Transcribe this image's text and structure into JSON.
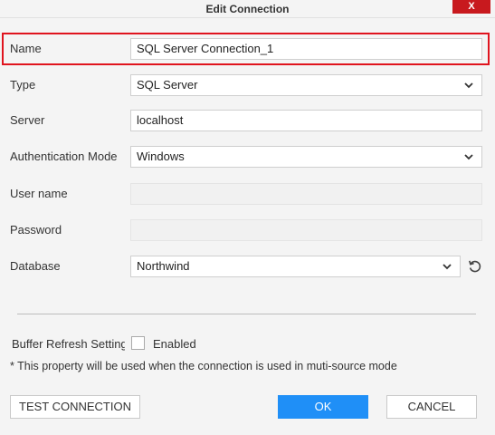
{
  "window": {
    "title": "Edit Connection",
    "close_label": "X"
  },
  "fields": {
    "name": {
      "label": "Name",
      "value": "SQL Server Connection_1"
    },
    "type": {
      "label": "Type",
      "value": "SQL Server"
    },
    "server": {
      "label": "Server",
      "value": "localhost"
    },
    "auth": {
      "label": "Authentication Mode",
      "value": "Windows"
    },
    "username": {
      "label": "User name",
      "value": ""
    },
    "password": {
      "label": "Password",
      "value": ""
    },
    "database": {
      "label": "Database",
      "value": "Northwind"
    }
  },
  "buffer": {
    "label": "Buffer Refresh Settings",
    "checkbox_label": "Enabled",
    "checked": false,
    "note": "* This property will be used when the connection is used in muti-source mode"
  },
  "buttons": {
    "test": "TEST CONNECTION",
    "ok": "OK",
    "cancel": "CANCEL"
  },
  "colors": {
    "accent": "#1f8ff7",
    "highlight": "#e0141e",
    "close": "#c8191e"
  },
  "icons": {
    "dropdown": "chevron-down-icon",
    "refresh": "refresh-icon"
  }
}
